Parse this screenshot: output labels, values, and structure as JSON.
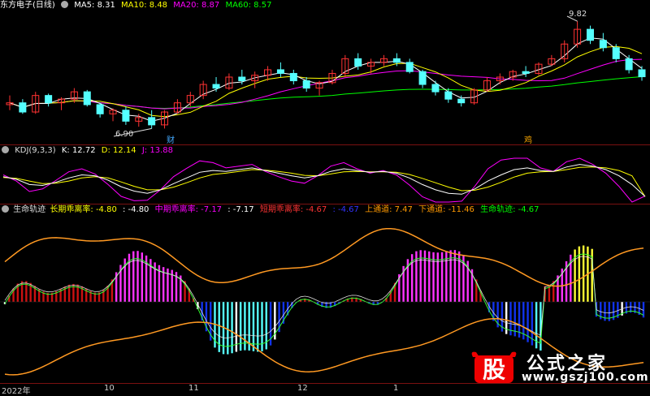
{
  "price_panel": {
    "title": "东方电子(日线)",
    "ma5": "MA5: 8.31",
    "ma10": "MA10: 8.48",
    "ma20": "MA20: 8.87",
    "ma60": "MA60: 8.57",
    "high_label": "9.82",
    "low_label": "6.90",
    "marker1": "财",
    "marker2": "鸡",
    "colors": {
      "up": "#ff3232",
      "down": "#54ffff",
      "ma5": "#ffffff",
      "ma10": "#ffff00",
      "ma20": "#ff00ff",
      "ma60": "#00ff00"
    }
  },
  "kdj_panel": {
    "name": "KDJ(9,3,3)",
    "k": "K: 12.72",
    "d": "D: 12.14",
    "j": "J: 13.88",
    "colors": {
      "k": "#ffffff",
      "d": "#ffff00",
      "j": "#ff00ff"
    }
  },
  "life_panel": {
    "name": "生命轨迹",
    "long_label": "长期乖离率:",
    "long_value": "-4.80",
    "long_extra": ": -4.80",
    "mid_label": "中期乖离率:",
    "mid_value": "-7.17",
    "mid_extra": ": -7.17",
    "short_label": "短期乖离率:",
    "short_value": "-4.67",
    "short_extra": ": -4.67",
    "upper_label": "上通道:",
    "upper_value": "7.47",
    "lower_label": "下通道:",
    "lower_value": "-11.46",
    "life_label": "生命轨迹:",
    "life_value": "-4.67"
  },
  "x_axis": {
    "labels": [
      "2022年",
      "10",
      "11",
      "12",
      "1"
    ]
  },
  "watermark": {
    "logo_char": "股",
    "title": "公式之家",
    "url": "www.gszj100.com"
  },
  "chart_data": [
    {
      "type": "candlestick",
      "title": "东方电子(日线)",
      "ohlc_approx": [
        [
          7.55,
          7.8,
          7.4,
          7.6
        ],
        [
          7.6,
          7.7,
          7.3,
          7.35
        ],
        [
          7.35,
          7.9,
          7.3,
          7.8
        ],
        [
          7.8,
          7.85,
          7.5,
          7.6
        ],
        [
          7.6,
          7.75,
          7.4,
          7.7
        ],
        [
          7.7,
          8.0,
          7.6,
          7.9
        ],
        [
          7.9,
          7.95,
          7.5,
          7.55
        ],
        [
          7.55,
          7.6,
          7.2,
          7.3
        ],
        [
          7.3,
          7.45,
          7.1,
          7.4
        ],
        [
          7.4,
          7.5,
          7.0,
          7.1
        ],
        [
          7.1,
          7.3,
          6.95,
          7.2
        ],
        [
          7.2,
          7.4,
          6.9,
          7.0
        ],
        [
          7.0,
          7.4,
          6.9,
          7.35
        ],
        [
          7.35,
          7.7,
          7.3,
          7.6
        ],
        [
          7.6,
          7.9,
          7.5,
          7.8
        ],
        [
          7.8,
          8.2,
          7.7,
          8.1
        ],
        [
          8.1,
          8.3,
          7.9,
          8.0
        ],
        [
          8.0,
          8.4,
          7.95,
          8.3
        ],
        [
          8.3,
          8.5,
          8.1,
          8.2
        ],
        [
          8.2,
          8.45,
          8.0,
          8.35
        ],
        [
          8.35,
          8.6,
          8.2,
          8.5
        ],
        [
          8.5,
          8.7,
          8.3,
          8.4
        ],
        [
          8.4,
          8.5,
          8.1,
          8.2
        ],
        [
          8.2,
          8.3,
          7.9,
          8.0
        ],
        [
          8.0,
          8.2,
          7.8,
          8.15
        ],
        [
          8.15,
          8.5,
          8.1,
          8.4
        ],
        [
          8.4,
          8.9,
          8.3,
          8.8
        ],
        [
          8.8,
          8.95,
          8.5,
          8.6
        ],
        [
          8.6,
          8.8,
          8.4,
          8.7
        ],
        [
          8.7,
          8.9,
          8.6,
          8.8
        ],
        [
          8.8,
          8.95,
          8.6,
          8.7
        ],
        [
          8.7,
          8.8,
          8.4,
          8.45
        ],
        [
          8.45,
          8.5,
          8.0,
          8.1
        ],
        [
          8.1,
          8.2,
          7.8,
          7.9
        ],
        [
          7.9,
          8.0,
          7.6,
          7.7
        ],
        [
          7.7,
          7.8,
          7.5,
          7.6
        ],
        [
          7.6,
          8.0,
          7.55,
          7.95
        ],
        [
          7.95,
          8.3,
          7.9,
          8.2
        ],
        [
          8.2,
          8.4,
          8.1,
          8.3
        ],
        [
          8.3,
          8.5,
          8.2,
          8.45
        ],
        [
          8.45,
          8.6,
          8.3,
          8.4
        ],
        [
          8.4,
          8.7,
          8.35,
          8.65
        ],
        [
          8.65,
          8.9,
          8.6,
          8.8
        ],
        [
          8.8,
          9.3,
          8.7,
          9.2
        ],
        [
          9.2,
          9.82,
          9.1,
          9.6
        ],
        [
          9.6,
          9.7,
          9.2,
          9.3
        ],
        [
          9.3,
          9.5,
          9.0,
          9.1
        ],
        [
          9.1,
          9.2,
          8.7,
          8.8
        ],
        [
          8.8,
          8.9,
          8.4,
          8.5
        ],
        [
          8.5,
          8.6,
          8.2,
          8.31
        ]
      ],
      "y_high": 9.82,
      "y_low": 6.9
    },
    {
      "type": "line",
      "title": "KDJ(9,3,3)",
      "series": [
        {
          "name": "K",
          "values": [
            58,
            52,
            40,
            38,
            45,
            55,
            62,
            60,
            50,
            35,
            25,
            20,
            28,
            42,
            55,
            68,
            72,
            70,
            74,
            78,
            72,
            66,
            60,
            55,
            60,
            70,
            76,
            72,
            68,
            70,
            66,
            55,
            40,
            28,
            20,
            18,
            30,
            48,
            62,
            74,
            78,
            72,
            70,
            80,
            86,
            82,
            74,
            60,
            40,
            12.72
          ]
        },
        {
          "name": "D",
          "values": [
            56,
            54,
            48,
            42,
            43,
            48,
            55,
            58,
            55,
            46,
            36,
            28,
            28,
            34,
            44,
            55,
            63,
            66,
            70,
            74,
            73,
            70,
            66,
            61,
            60,
            64,
            69,
            70,
            69,
            69,
            68,
            63,
            54,
            44,
            34,
            26,
            27,
            34,
            45,
            57,
            66,
            69,
            70,
            74,
            79,
            80,
            78,
            72,
            60,
            12.14
          ]
        },
        {
          "name": "J",
          "values": [
            62,
            48,
            24,
            30,
            49,
            69,
            76,
            64,
            40,
            13,
            3,
            4,
            28,
            58,
            77,
            94,
            90,
            78,
            82,
            86,
            70,
            58,
            48,
            43,
            60,
            82,
            90,
            76,
            66,
            72,
            62,
            39,
            12,
            0,
            0,
            2,
            36,
            76,
            96,
            100,
            100,
            78,
            70,
            92,
            100,
            86,
            66,
            36,
            0,
            13.88
          ]
        }
      ]
    },
    {
      "type": "bar",
      "title": "生命轨迹",
      "series": [
        {
          "name": "长期乖离率",
          "values": [
            -4.8
          ]
        },
        {
          "name": "中期乖离率",
          "values": [
            -7.17
          ]
        },
        {
          "name": "短期乖离率",
          "values": [
            -4.67
          ]
        },
        {
          "name": "上通道",
          "values": [
            7.47
          ]
        },
        {
          "name": "下通道",
          "values": [
            -11.46
          ]
        },
        {
          "name": "生命轨迹",
          "values": [
            -4.67
          ]
        }
      ]
    }
  ]
}
